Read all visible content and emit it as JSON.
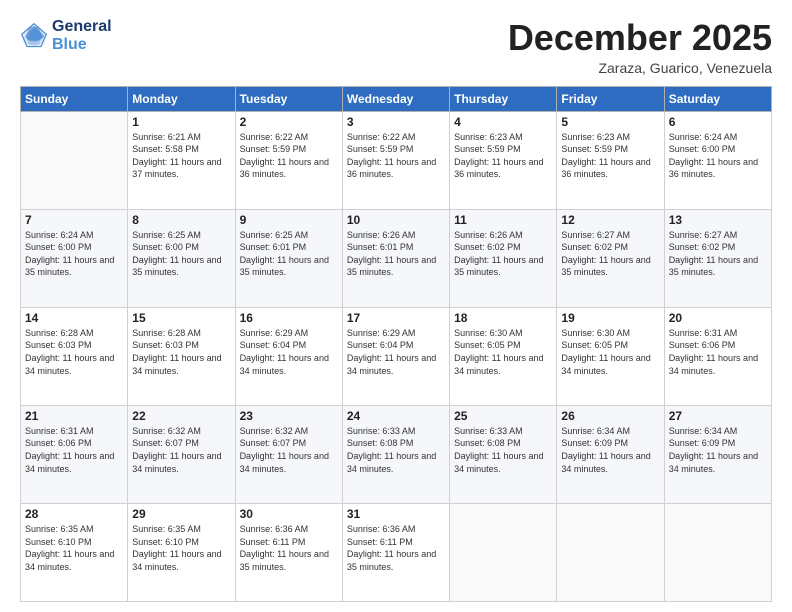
{
  "header": {
    "logo_line1": "General",
    "logo_line2": "Blue",
    "month": "December 2025",
    "location": "Zaraza, Guarico, Venezuela"
  },
  "weekdays": [
    "Sunday",
    "Monday",
    "Tuesday",
    "Wednesday",
    "Thursday",
    "Friday",
    "Saturday"
  ],
  "weeks": [
    [
      {
        "day": "",
        "sunrise": "",
        "sunset": "",
        "daylight": ""
      },
      {
        "day": "1",
        "sunrise": "Sunrise: 6:21 AM",
        "sunset": "Sunset: 5:58 PM",
        "daylight": "Daylight: 11 hours and 37 minutes."
      },
      {
        "day": "2",
        "sunrise": "Sunrise: 6:22 AM",
        "sunset": "Sunset: 5:59 PM",
        "daylight": "Daylight: 11 hours and 36 minutes."
      },
      {
        "day": "3",
        "sunrise": "Sunrise: 6:22 AM",
        "sunset": "Sunset: 5:59 PM",
        "daylight": "Daylight: 11 hours and 36 minutes."
      },
      {
        "day": "4",
        "sunrise": "Sunrise: 6:23 AM",
        "sunset": "Sunset: 5:59 PM",
        "daylight": "Daylight: 11 hours and 36 minutes."
      },
      {
        "day": "5",
        "sunrise": "Sunrise: 6:23 AM",
        "sunset": "Sunset: 5:59 PM",
        "daylight": "Daylight: 11 hours and 36 minutes."
      },
      {
        "day": "6",
        "sunrise": "Sunrise: 6:24 AM",
        "sunset": "Sunset: 6:00 PM",
        "daylight": "Daylight: 11 hours and 36 minutes."
      }
    ],
    [
      {
        "day": "7",
        "sunrise": "Sunrise: 6:24 AM",
        "sunset": "Sunset: 6:00 PM",
        "daylight": "Daylight: 11 hours and 35 minutes."
      },
      {
        "day": "8",
        "sunrise": "Sunrise: 6:25 AM",
        "sunset": "Sunset: 6:00 PM",
        "daylight": "Daylight: 11 hours and 35 minutes."
      },
      {
        "day": "9",
        "sunrise": "Sunrise: 6:25 AM",
        "sunset": "Sunset: 6:01 PM",
        "daylight": "Daylight: 11 hours and 35 minutes."
      },
      {
        "day": "10",
        "sunrise": "Sunrise: 6:26 AM",
        "sunset": "Sunset: 6:01 PM",
        "daylight": "Daylight: 11 hours and 35 minutes."
      },
      {
        "day": "11",
        "sunrise": "Sunrise: 6:26 AM",
        "sunset": "Sunset: 6:02 PM",
        "daylight": "Daylight: 11 hours and 35 minutes."
      },
      {
        "day": "12",
        "sunrise": "Sunrise: 6:27 AM",
        "sunset": "Sunset: 6:02 PM",
        "daylight": "Daylight: 11 hours and 35 minutes."
      },
      {
        "day": "13",
        "sunrise": "Sunrise: 6:27 AM",
        "sunset": "Sunset: 6:02 PM",
        "daylight": "Daylight: 11 hours and 35 minutes."
      }
    ],
    [
      {
        "day": "14",
        "sunrise": "Sunrise: 6:28 AM",
        "sunset": "Sunset: 6:03 PM",
        "daylight": "Daylight: 11 hours and 34 minutes."
      },
      {
        "day": "15",
        "sunrise": "Sunrise: 6:28 AM",
        "sunset": "Sunset: 6:03 PM",
        "daylight": "Daylight: 11 hours and 34 minutes."
      },
      {
        "day": "16",
        "sunrise": "Sunrise: 6:29 AM",
        "sunset": "Sunset: 6:04 PM",
        "daylight": "Daylight: 11 hours and 34 minutes."
      },
      {
        "day": "17",
        "sunrise": "Sunrise: 6:29 AM",
        "sunset": "Sunset: 6:04 PM",
        "daylight": "Daylight: 11 hours and 34 minutes."
      },
      {
        "day": "18",
        "sunrise": "Sunrise: 6:30 AM",
        "sunset": "Sunset: 6:05 PM",
        "daylight": "Daylight: 11 hours and 34 minutes."
      },
      {
        "day": "19",
        "sunrise": "Sunrise: 6:30 AM",
        "sunset": "Sunset: 6:05 PM",
        "daylight": "Daylight: 11 hours and 34 minutes."
      },
      {
        "day": "20",
        "sunrise": "Sunrise: 6:31 AM",
        "sunset": "Sunset: 6:06 PM",
        "daylight": "Daylight: 11 hours and 34 minutes."
      }
    ],
    [
      {
        "day": "21",
        "sunrise": "Sunrise: 6:31 AM",
        "sunset": "Sunset: 6:06 PM",
        "daylight": "Daylight: 11 hours and 34 minutes."
      },
      {
        "day": "22",
        "sunrise": "Sunrise: 6:32 AM",
        "sunset": "Sunset: 6:07 PM",
        "daylight": "Daylight: 11 hours and 34 minutes."
      },
      {
        "day": "23",
        "sunrise": "Sunrise: 6:32 AM",
        "sunset": "Sunset: 6:07 PM",
        "daylight": "Daylight: 11 hours and 34 minutes."
      },
      {
        "day": "24",
        "sunrise": "Sunrise: 6:33 AM",
        "sunset": "Sunset: 6:08 PM",
        "daylight": "Daylight: 11 hours and 34 minutes."
      },
      {
        "day": "25",
        "sunrise": "Sunrise: 6:33 AM",
        "sunset": "Sunset: 6:08 PM",
        "daylight": "Daylight: 11 hours and 34 minutes."
      },
      {
        "day": "26",
        "sunrise": "Sunrise: 6:34 AM",
        "sunset": "Sunset: 6:09 PM",
        "daylight": "Daylight: 11 hours and 34 minutes."
      },
      {
        "day": "27",
        "sunrise": "Sunrise: 6:34 AM",
        "sunset": "Sunset: 6:09 PM",
        "daylight": "Daylight: 11 hours and 34 minutes."
      }
    ],
    [
      {
        "day": "28",
        "sunrise": "Sunrise: 6:35 AM",
        "sunset": "Sunset: 6:10 PM",
        "daylight": "Daylight: 11 hours and 34 minutes."
      },
      {
        "day": "29",
        "sunrise": "Sunrise: 6:35 AM",
        "sunset": "Sunset: 6:10 PM",
        "daylight": "Daylight: 11 hours and 34 minutes."
      },
      {
        "day": "30",
        "sunrise": "Sunrise: 6:36 AM",
        "sunset": "Sunset: 6:11 PM",
        "daylight": "Daylight: 11 hours and 35 minutes."
      },
      {
        "day": "31",
        "sunrise": "Sunrise: 6:36 AM",
        "sunset": "Sunset: 6:11 PM",
        "daylight": "Daylight: 11 hours and 35 minutes."
      },
      {
        "day": "",
        "sunrise": "",
        "sunset": "",
        "daylight": ""
      },
      {
        "day": "",
        "sunrise": "",
        "sunset": "",
        "daylight": ""
      },
      {
        "day": "",
        "sunrise": "",
        "sunset": "",
        "daylight": ""
      }
    ]
  ]
}
